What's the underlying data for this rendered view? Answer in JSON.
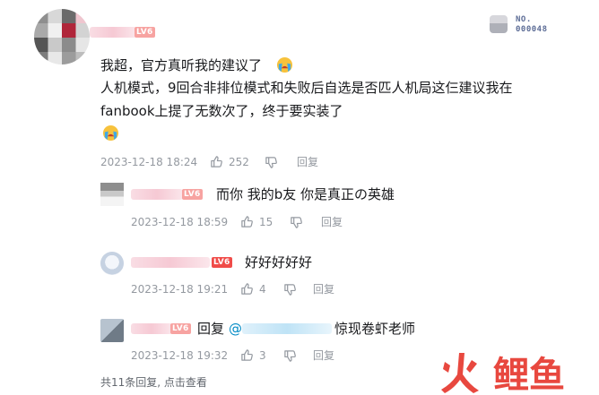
{
  "main_comment": {
    "lines": [
      "我超，官方真听我的建议了",
      "人机模式，9回合非排位模式和失败后自选是否匹人机局这仨建议我在",
      "fanbook上提了无数次了，终于要实装了"
    ],
    "timestamp": "2023-12-18 18:24",
    "likes": "252",
    "reply_label": "回复"
  },
  "badge": {
    "line1": "NO.",
    "line2": "000048"
  },
  "level_tag": "LV6",
  "replies": [
    {
      "text": "而你 我的b友 你是真正の英雄",
      "timestamp": "2023-12-18 18:59",
      "likes": "15",
      "reply_label": "回复"
    },
    {
      "text": "好好好好好",
      "timestamp": "2023-12-18 19:21",
      "likes": "4",
      "reply_label": "回复"
    },
    {
      "prefix": "回复",
      "mention": "@",
      "text": "惊现卷虾老师",
      "timestamp": "2023-12-18 19:32",
      "likes": "3",
      "reply_label": "回复"
    }
  ],
  "more_replies": "共11条回复, 点击查看",
  "watermark": "火鲤鱼",
  "colors": {
    "level": "#f04c49",
    "mention": "#008ac5",
    "meta": "#9499a0",
    "watermark": "#e8483f"
  },
  "icons": [
    "thumb-up-icon",
    "thumb-down-icon",
    "crying-emoji-icon"
  ]
}
